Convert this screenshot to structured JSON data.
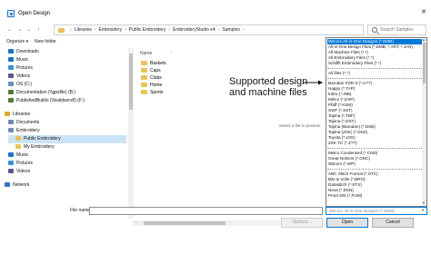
{
  "window": {
    "title": "Open Design",
    "close_glyph": "✕"
  },
  "nav": {
    "back": "←",
    "forward": "→",
    "recent": "⌄",
    "up": "↑",
    "breadcrumbs": [
      "Libraries",
      "Embroidery",
      "Public Embroidery",
      "EmbroideryStudio e4",
      "Samples"
    ],
    "refresh": "↻",
    "dropdown": "⌄"
  },
  "search": {
    "placeholder": "Search Samples"
  },
  "toolbar": {
    "organize": "Organize ▾",
    "new_folder": "New folder"
  },
  "sidebar": {
    "items": [
      {
        "label": "Downloads",
        "icon": "download-icon",
        "color": "#1f6fcf"
      },
      {
        "label": "Music",
        "icon": "music-icon",
        "color": "#1f6fcf"
      },
      {
        "label": "Pictures",
        "icon": "pictures-icon",
        "color": "#3b8fd9"
      },
      {
        "label": "Videos",
        "icon": "videos-icon",
        "color": "#5a5a8a"
      },
      {
        "label": "OS (C:)",
        "icon": "drive-icon",
        "color": "#6a8fb5"
      },
      {
        "label": "Documentation (\\\\gpsfile) (B:)",
        "icon": "network-drive-icon",
        "color": "#4f7d3b"
      },
      {
        "label": "PublishedBuilds (\\\\buildserv8) (F:)",
        "icon": "network-drive-icon",
        "color": "#4f7d3b"
      },
      {
        "label": "Libraries",
        "icon": "libraries-icon",
        "color": "#e0a92b"
      },
      {
        "label": "Documents",
        "icon": "documents-icon",
        "color": "#6e8db3"
      },
      {
        "label": "Embroidery",
        "icon": "library-icon",
        "color": "#6e8db3"
      },
      {
        "label": "Public Embroidery",
        "icon": "folder-icon",
        "color": "#e8c45c"
      },
      {
        "label": "My Embroidery",
        "icon": "folder-icon",
        "color": "#e8c45c"
      },
      {
        "label": "Music",
        "icon": "music-icon",
        "color": "#1f6fcf"
      },
      {
        "label": "Pictures",
        "icon": "pictures-icon",
        "color": "#3b8fd9"
      },
      {
        "label": "Videos",
        "icon": "videos-icon",
        "color": "#5a5a8a"
      },
      {
        "label": "Network",
        "icon": "network-icon",
        "color": "#2e72c9"
      }
    ],
    "selected_index": 10
  },
  "files": {
    "column_name": "Name",
    "sort_arrow": "^",
    "items": [
      "Baskets",
      "Caps",
      "Clubs",
      "Home",
      "Sports"
    ],
    "preview_text": "Select a file to preview."
  },
  "annotation": {
    "line1": "Supported design",
    "line2": "and machine files"
  },
  "filetype_list": {
    "groups": [
      [
        "Wilcom All-in-One Designs (*.EMB)",
        "All-in-One Design Files (*.EMB; *.ART; *.JAN)",
        "All Machine Files (*.*)",
        "All Embroidery Files (*.*)",
        "Schiffli Embroidery Files (*.*)"
      ],
      [
        "All files (*.*)"
      ],
      [
        "Barudan FDR-3 (*.U??)",
        "Happy (*.TAP)",
        "Inbro (*.INB)",
        "Melco (*.EXP)",
        "Pfaff (*.KSM)",
        "SWF (*.SST)",
        "Tajima (*.TBF)",
        "Tajima (*.DST)",
        "Tajima (Barudan) (*.DSB)",
        "Tajima (ZSK) (*.DSZ)",
        "Toyota (*.10O)",
        "ZSK TC (*.Z??)"
      ],
      [
        "Melco Condensed (*.CND)",
        "Great Notions (*.GNC)",
        "Wilcom (*.WP)"
      ],
      [
        "ABC Stitch Format (*.STC)",
        "Bits & Volts (*.BRO)",
        "Datastitch (*.STX)",
        "Nova (*.DSN)",
        "Proel 205 (*.PUM)"
      ]
    ],
    "selected": "Wilcom All-in-One Designs (*.EMB)"
  },
  "bottom": {
    "file_name_label": "File name:",
    "file_name_value": "",
    "filetype_value": "Wilcom All-in-One Designs (*.EMB)",
    "options_label": "Options...",
    "open_label": "Open",
    "cancel_label": "Cancel"
  },
  "colors": {
    "accent": "#0078d7",
    "selection": "#cce4f7",
    "folder": "#e8c45c"
  }
}
